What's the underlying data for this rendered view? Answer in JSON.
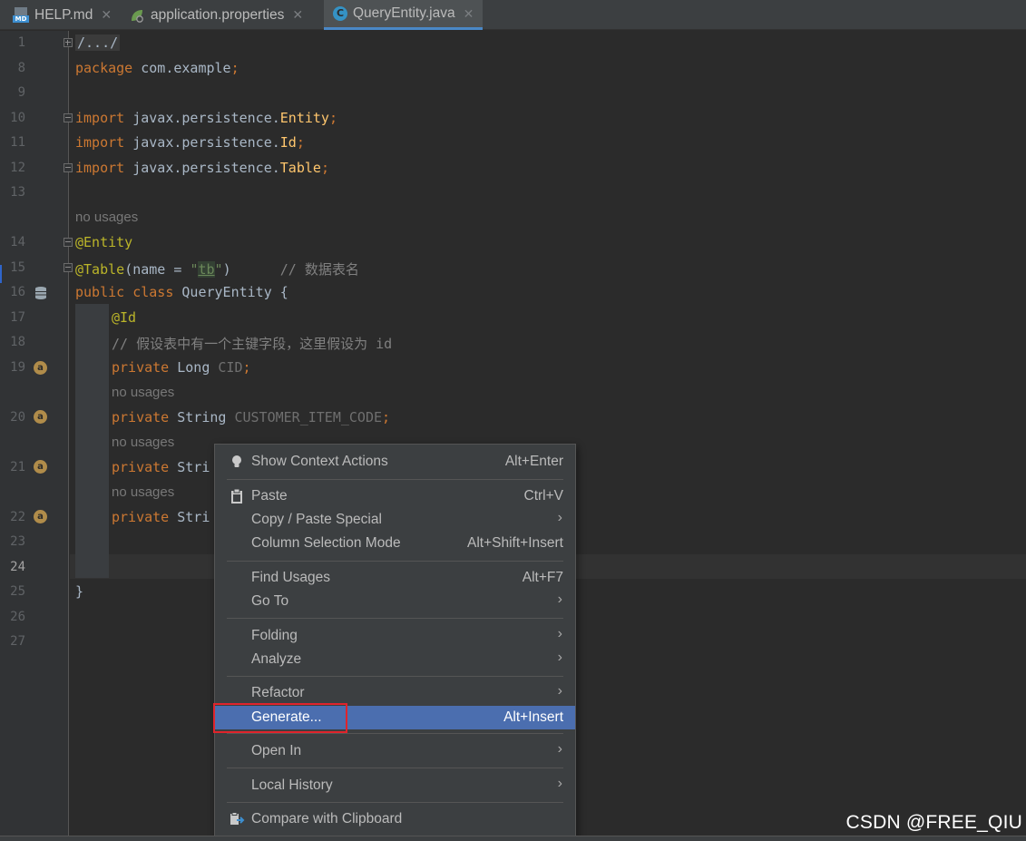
{
  "tabs": [
    {
      "label": "HELP.md",
      "icon": "markdown-file-icon",
      "active": false
    },
    {
      "label": "application.properties",
      "icon": "spring-leaf-icon",
      "active": false
    },
    {
      "label": "QueryEntity.java",
      "icon": "java-class-icon",
      "active": true
    }
  ],
  "line_numbers": [
    "1",
    "8",
    "9",
    "10",
    "11",
    "12",
    "13",
    "14",
    "15",
    "16",
    "17",
    "18",
    "19",
    "20",
    "21",
    "22",
    "23",
    "24",
    "25",
    "26",
    "27"
  ],
  "code": {
    "l1": "/.../",
    "l8_kw": "package",
    "l8_rest": " com.example",
    "semi": ";",
    "import_kw": "import",
    "l10_pkg": " javax.persistence.",
    "l10_cls": "Entity",
    "l11_cls": "Id",
    "l12_cls": "Table",
    "no_usages": "no usages",
    "l14": "@Entity",
    "l15_anno": "@Table",
    "l15_open": "(name = ",
    "l15_q": "\"",
    "l15_tb": "tb",
    "l15_close": ")",
    "l15_cmt": "// 数据表名",
    "l16_public": "public",
    "l16_class": "class",
    "l16_name": " QueryEntity ",
    "l16_brace": "{",
    "l17": "@Id",
    "l18": "// 假设表中有一个主键字段，这里假设为 id",
    "private": "private",
    "l19_type": " Long ",
    "l19_field": "CID",
    "l20_type": " String ",
    "l20_field": "CUSTOMER_ITEM_CODE",
    "l21_trunc": " Stri",
    "l22_trunc": " Stri",
    "l25": "}"
  },
  "context_menu": {
    "items": [
      {
        "label": "Show Context Actions",
        "shortcut": "Alt+Enter",
        "icon": "lightbulb-icon"
      },
      {
        "label": "Paste",
        "shortcut": "Ctrl+V",
        "icon": "clipboard-icon"
      },
      {
        "label": "Copy / Paste Special",
        "submenu": true
      },
      {
        "label": "Column Selection Mode",
        "shortcut": "Alt+Shift+Insert"
      },
      {
        "label": "Find Usages",
        "shortcut": "Alt+F7"
      },
      {
        "label": "Go To",
        "submenu": true
      },
      {
        "label": "Folding",
        "submenu": true
      },
      {
        "label": "Analyze",
        "submenu": true
      },
      {
        "label": "Refactor",
        "submenu": true
      },
      {
        "label": "Generate...",
        "shortcut": "Alt+Insert",
        "selected": true
      },
      {
        "label": "Open In",
        "submenu": true
      },
      {
        "label": "Local History",
        "submenu": true
      },
      {
        "label": "Compare with Clipboard",
        "icon": "compare-clipboard-icon"
      }
    ]
  },
  "watermark": "CSDN @FREE_QIU",
  "colors": {
    "background": "#2b2b2b",
    "keyword": "#cc7832",
    "annotation": "#bbb529",
    "comment": "#808080",
    "string": "#6a8759",
    "field": "#9876aa",
    "menu_selected": "#4b6eaf",
    "highlight_box": "#e0242b"
  }
}
